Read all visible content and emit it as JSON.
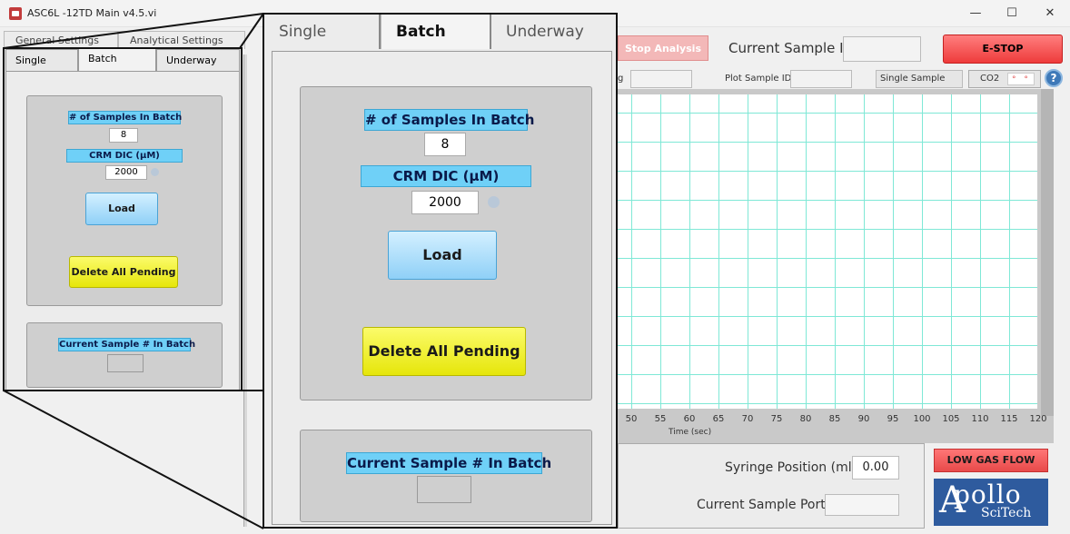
{
  "window": {
    "title": "ASC6L -12TD Main v4.5.vi",
    "minimize": "—",
    "maximize": "☐",
    "close": "✕"
  },
  "top_tabs": [
    "General Settings",
    "Analytical Settings"
  ],
  "sub_tabs": [
    "Single",
    "Batch",
    "Underway"
  ],
  "batch": {
    "samples_label": "# of Samples In Batch",
    "samples_value": "8",
    "crm_label": "CRM DIC (µM)",
    "crm_value": "2000",
    "load_label": "Load",
    "delete_label": "Delete All Pending",
    "current_sample_label": "Current Sample # In Batch",
    "current_sample_value": ""
  },
  "header": {
    "stop_analysis": "Stop Analysis",
    "current_sample_id_label": "Current Sample ID",
    "current_sample_id_value": "",
    "estop": "E-STOP"
  },
  "plot_bar": {
    "left_label_fragment": "g",
    "plot_sample_id_label": "Plot Sample ID",
    "plot_sample_id_value": "",
    "mode": "Single Sample",
    "legend_label": "CO2",
    "help": "?"
  },
  "chart_data": {
    "type": "line",
    "title": "",
    "xlabel": "Time (sec)",
    "ylabel": "",
    "x_ticks": [
      "50",
      "55",
      "60",
      "65",
      "70",
      "75",
      "80",
      "85",
      "90",
      "95",
      "100",
      "105",
      "110",
      "115",
      "120"
    ],
    "series": [],
    "grid": true
  },
  "bottom": {
    "syringe_label": "Syringe Position (ml)",
    "syringe_value": "0.00",
    "port_label": "Current Sample Port",
    "port_value": "",
    "low_gas": "LOW GAS FLOW",
    "logo_text": "pollo",
    "logo_a": "A",
    "logo_sub": "SciTech"
  },
  "colors": {
    "accent_blue": "#6fd0f7",
    "delete_yellow": "#f0f020",
    "estop_red": "#ee3b3b",
    "grid_teal": "#7fe8d6"
  }
}
